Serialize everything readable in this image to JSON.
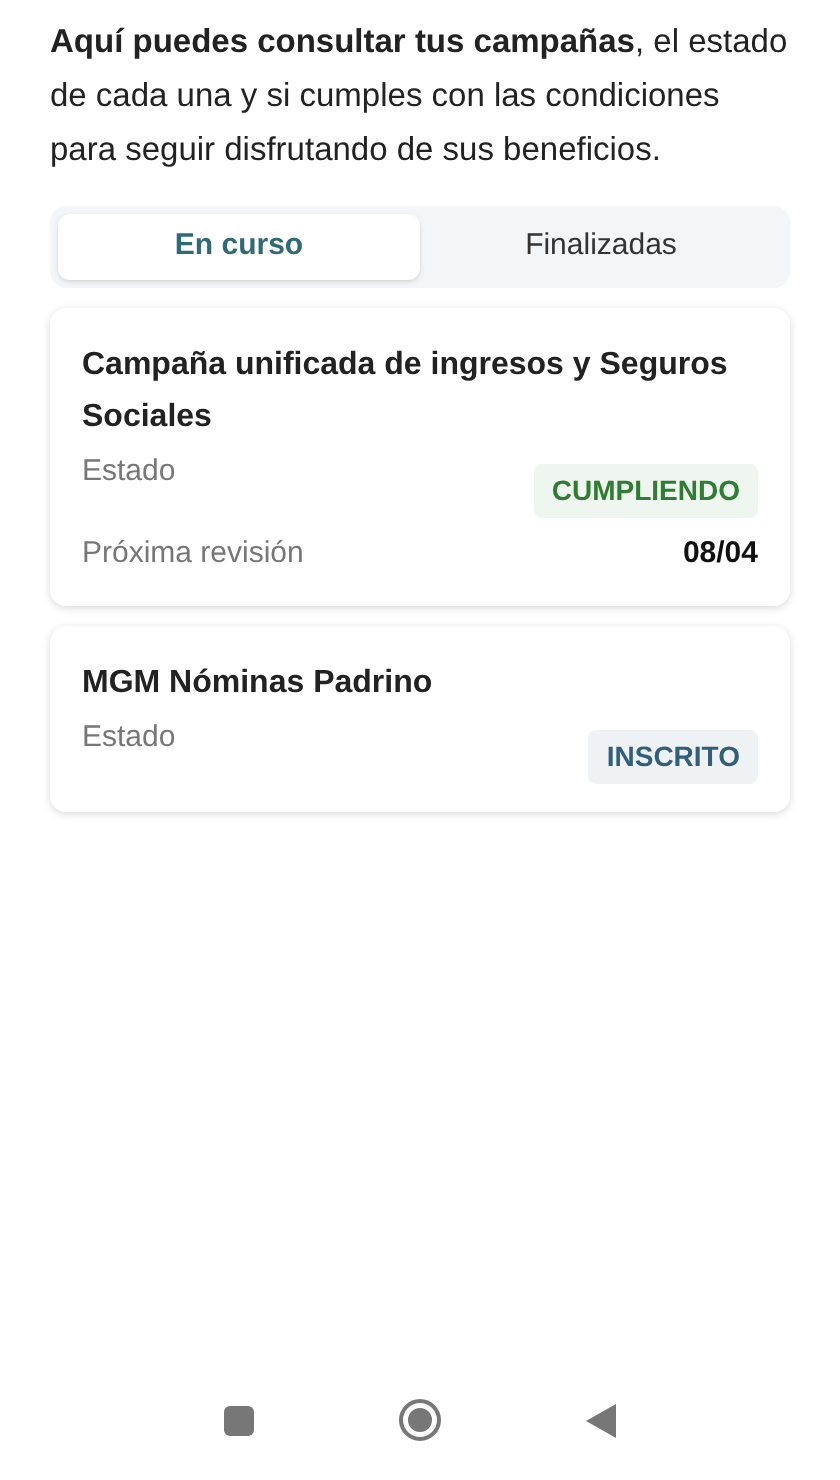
{
  "intro": "**Aquí puedes consultar tus campañas**, el estado de cada una y si cumples con las condiciones para seguir disfrutando de sus beneficios.",
  "tabs": [
    {
      "label": "En curso",
      "selected": true
    },
    {
      "label": "Finalizadas",
      "selected": false
    }
  ],
  "campaigns": [
    {
      "title": "Campaña unificada de ingresos y Seguros Sociales",
      "rows": [
        {
          "label": "Estado",
          "kind": "badge",
          "value": "CUMPLIENDO",
          "color": "#2e7d32"
        },
        {
          "label": "Próxima revisión",
          "kind": "text",
          "value": "08/04"
        }
      ]
    },
    {
      "title": "MGM Nóminas Padrino",
      "rows": [
        {
          "label": "Estado",
          "kind": "badge",
          "value": "INSCRITO",
          "color": "#2f5f7a"
        }
      ]
    }
  ]
}
